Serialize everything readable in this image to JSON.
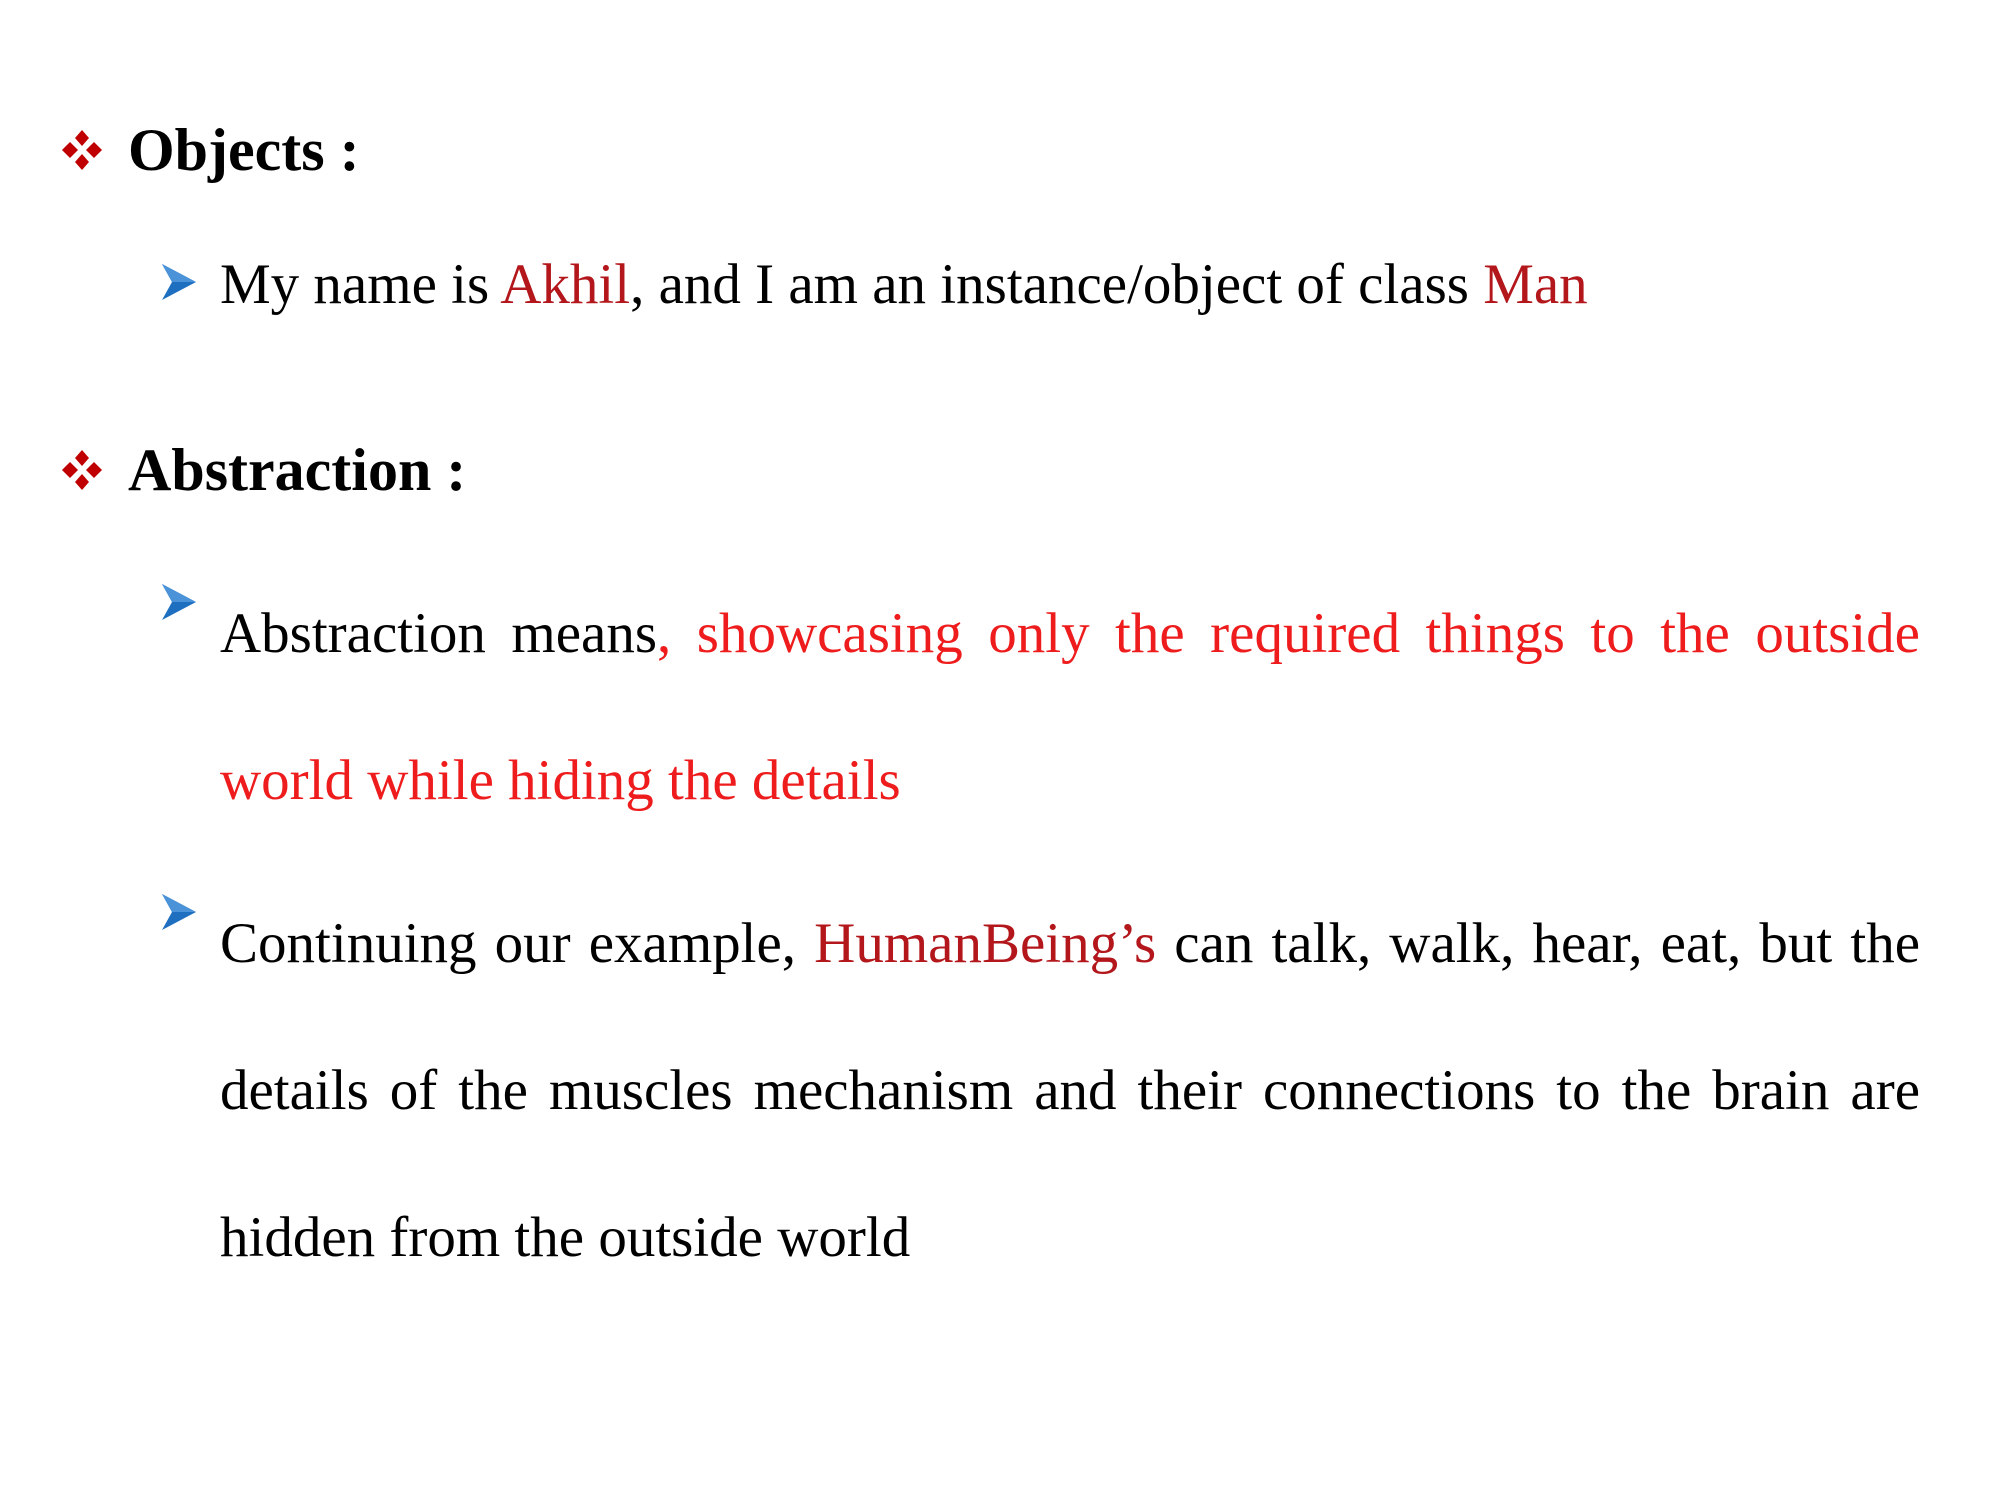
{
  "colors": {
    "bullet_red": "#c00000",
    "arrow_blue": "#1f6fc0",
    "highlight_dark_red": "#b3171c",
    "highlight_bright_red": "#ee1c1c",
    "text": "#000000"
  },
  "icons": {
    "section_bullet": "four-diamond-icon",
    "item_bullet": "arrow-right-icon"
  },
  "sections": {
    "objects": {
      "heading": "Objects :",
      "items": [
        {
          "p1": "My name is ",
          "h1": "Akhil",
          "p2": ", and I am an instance/object of class ",
          "h2": "Man"
        }
      ]
    },
    "abstraction": {
      "heading": "Abstraction :",
      "items": [
        {
          "p1": "Abstraction means",
          "h1": ", showcasing only the required things to the outside world while hiding the details"
        },
        {
          "p1": "Continuing our example, ",
          "h1": "HumanBeing’s",
          "p2": " can talk, walk, hear, eat, but the details of the muscles mechanism and their connections to the brain are hidden from the outside world"
        }
      ]
    }
  }
}
